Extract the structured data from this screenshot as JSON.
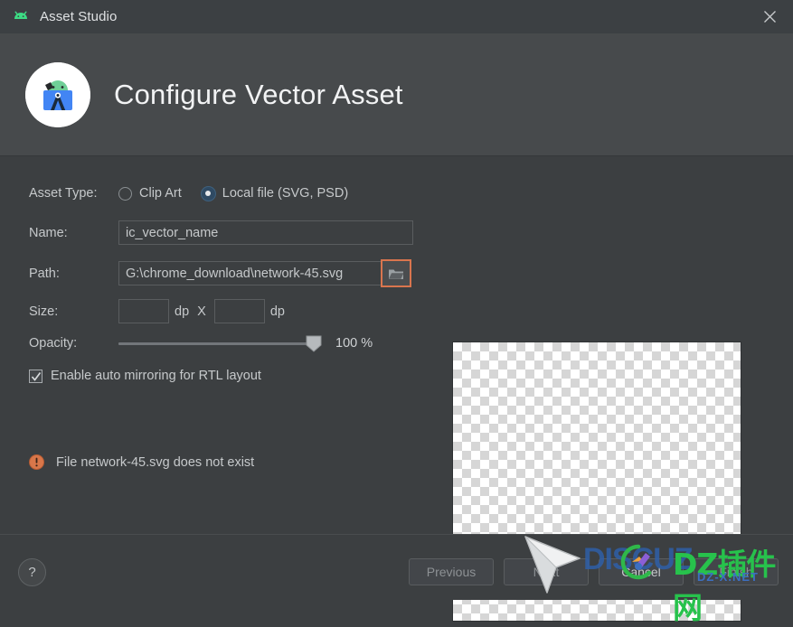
{
  "window": {
    "title": "Asset Studio",
    "app_icon": "android-head-icon",
    "close_icon": "close-icon"
  },
  "header": {
    "title": "Configure Vector Asset",
    "icon": "android-studio-vector-asset-icon"
  },
  "form": {
    "asset_type": {
      "label": "Asset Type:",
      "options": [
        {
          "label": "Clip Art",
          "selected": false
        },
        {
          "label": "Local file (SVG, PSD)",
          "selected": true
        }
      ]
    },
    "name": {
      "label": "Name:",
      "value": "ic_vector_name",
      "placeholder": ""
    },
    "path": {
      "label": "Path:",
      "value": "G:\\chrome_download\\network-45.svg",
      "placeholder": "",
      "browse_icon": "folder-icon"
    },
    "size": {
      "label": "Size:",
      "width_value": "",
      "height_value": "",
      "unit": "dp",
      "separator": "X"
    },
    "opacity": {
      "label": "Opacity:",
      "value": "100 %",
      "percent": 100
    },
    "mirror": {
      "label": "Enable auto mirroring for RTL layout",
      "checked": true
    }
  },
  "error": {
    "icon": "error-circle-icon",
    "text": "File network-45.svg does not exist"
  },
  "preview": {
    "name": "vector-preview-checkerboard"
  },
  "footer": {
    "help_label": "?",
    "buttons": [
      {
        "label": "Previous",
        "enabled": false
      },
      {
        "label": "Next",
        "enabled": false
      },
      {
        "label": "Cancel",
        "enabled": true
      },
      {
        "label": "Finish",
        "enabled": false
      }
    ]
  },
  "watermark": {
    "brand": "DISCUZ",
    "site_cn": "DZ插件网",
    "url": "DZ-X.NET",
    "logo": "discuz-logo-icon",
    "cursor": "mouse-cursor-icon"
  },
  "colors": {
    "window_bg": "#3c3f41",
    "header_bg": "#474a4c",
    "accent_focus": "#d9754e",
    "radio_selected": "#2f4a63",
    "error": "#d9774a",
    "text": "#c6c9cb"
  }
}
